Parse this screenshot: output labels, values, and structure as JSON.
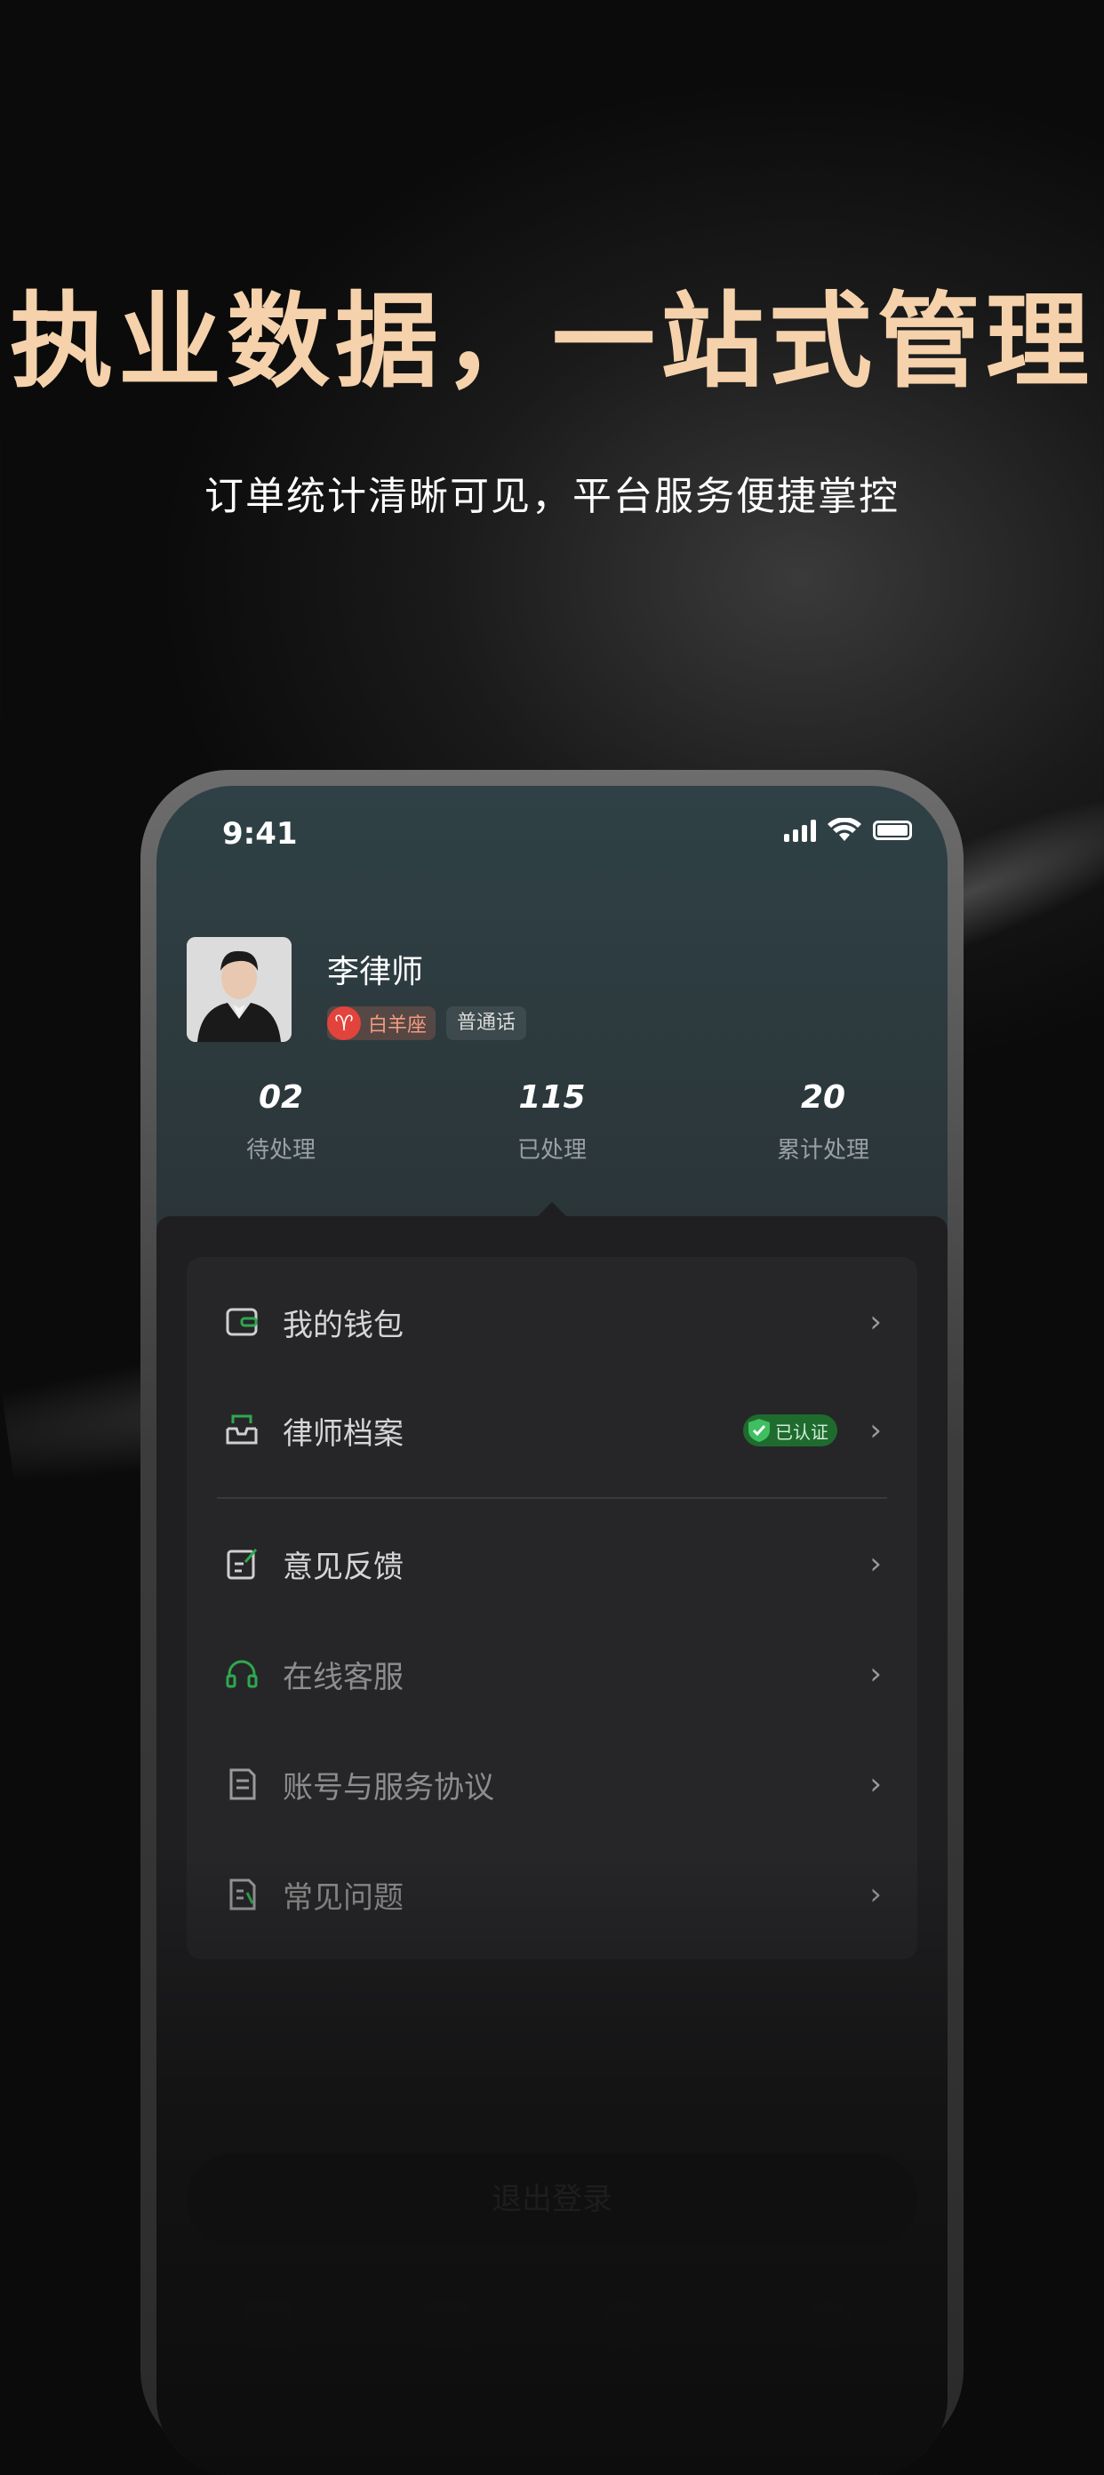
{
  "promo": {
    "headline": "执业数据，一站式管理",
    "subline": "订单统计清晰可见，平台服务便捷掌控"
  },
  "status_bar": {
    "time": "9:41",
    "icons": [
      "cellular-signal-icon",
      "wifi-icon",
      "battery-icon"
    ]
  },
  "profile": {
    "name": "李律师",
    "zodiac_tag": "白羊座",
    "zodiac_symbol": "♈",
    "language_tag": "普通话"
  },
  "stats": [
    {
      "value": "02",
      "label": "待处理"
    },
    {
      "value": "115",
      "label": "已处理"
    },
    {
      "value": "20",
      "label": "累计处理"
    }
  ],
  "menu": {
    "wallet": {
      "label": "我的钱包",
      "icon": "wallet-icon"
    },
    "lawyer_profile": {
      "label": "律师档案",
      "icon": "profile-box-icon",
      "badge": "已认证"
    },
    "feedback": {
      "label": "意见反馈",
      "icon": "edit-note-icon"
    },
    "support": {
      "label": "在线客服",
      "icon": "headset-icon"
    },
    "agreement": {
      "label": "账号与服务协议",
      "icon": "document-icon"
    },
    "faq": {
      "label": "常见问题",
      "icon": "faq-doc-icon"
    }
  },
  "logout_label": "退出登录",
  "colors": {
    "headline": "#F5D2AB",
    "accent_green": "#2FA84F",
    "zodiac_red": "#E2433C"
  }
}
